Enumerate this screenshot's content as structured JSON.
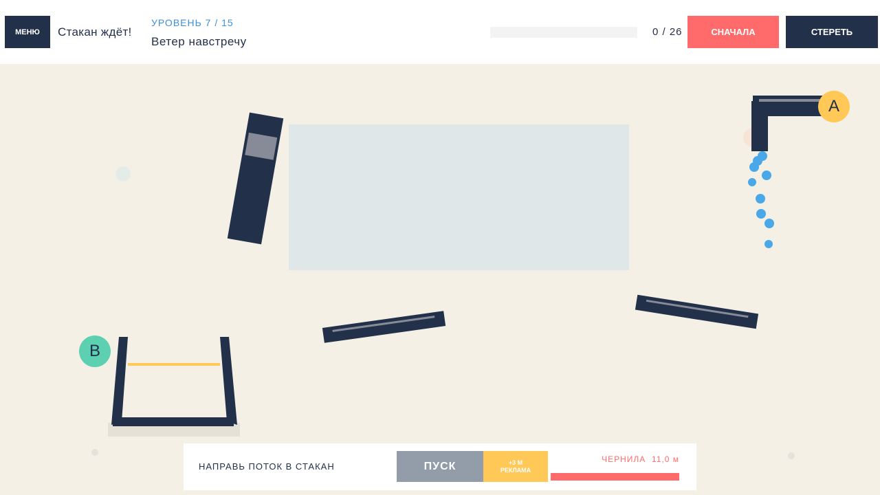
{
  "header": {
    "menu_label": "МЕНЮ",
    "tagline": "Стакан ждёт!",
    "level_label": "УРОВЕНЬ 7 / 15",
    "level_name": "Ветер навстречу",
    "progress": {
      "filled": 0,
      "total": 26,
      "counter_text": "0 / 26"
    },
    "restart_label": "СНАЧАЛА",
    "erase_label": "СТЕРЕТЬ"
  },
  "scene": {
    "source_label": "A",
    "target_label": "B"
  },
  "footer": {
    "hint": "НАПРАВЬ ПОТОК В СТАКАН",
    "play_label": "ПУСК",
    "ad_line1": "+3 М",
    "ad_line2": "РЕКЛАМА",
    "ink_label": "ЧЕРНИЛА  11,0 м",
    "ink_fraction": 1.0
  },
  "colors": {
    "background": "#f5f0e6",
    "dark": "#22304a",
    "water": "#4aa8e8",
    "restart": "#ff6b6b",
    "source": "#ffc857",
    "target": "#5cd0b0",
    "play_disabled": "#939daa"
  },
  "icons": {
    "source_marker": "circle-badge",
    "target_marker": "circle-badge"
  }
}
